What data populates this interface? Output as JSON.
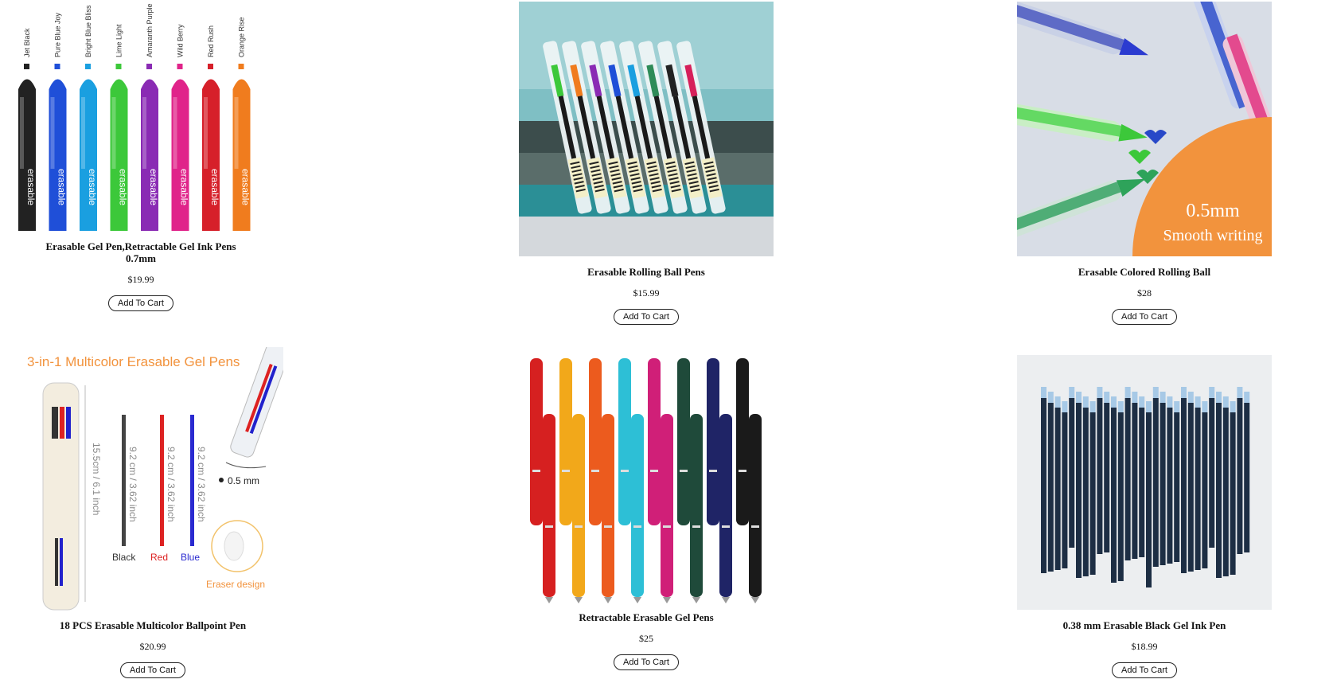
{
  "products": [
    {
      "title": "Erasable Gel Pen,Retractable Gel Ink Pens 0.7mm",
      "price": "$19.99",
      "button": "Add To Cart",
      "image_labels": [
        "Jet Black",
        "Pure Blue Joy",
        "Bright Blue Bliss",
        "Lime Light",
        "Amaranth Purple",
        "Wild Berry",
        "Red Rush",
        "Orange Rise"
      ],
      "barrel_text": "erasable",
      "colors": [
        "#222222",
        "#1f4fd8",
        "#1a9fe0",
        "#3cc83a",
        "#8a2bb4",
        "#e0248a",
        "#d6202a",
        "#f07c1e"
      ]
    },
    {
      "title": "Erasable Rolling Ball Pens",
      "price": "$15.99",
      "button": "Add To Cart",
      "colors": [
        "#3cc83a",
        "#f07c1e",
        "#8a2bb4",
        "#1f4fd8",
        "#1a9fe0",
        "#2e8b57",
        "#222222",
        "#d6205a"
      ]
    },
    {
      "title": "Erasable Colored Rolling Ball",
      "price": "$28",
      "button": "Add To Cart",
      "badge_size": "0.5mm",
      "badge_text": "Smooth writing"
    },
    {
      "title": "18 PCS Erasable Multicolor Ballpoint Pen",
      "price": "$20.99",
      "button": "Add To Cart",
      "header": "3-in-1 Multicolor Erasable Gel Pens",
      "length_label": "15.5cm / 6.1 inch",
      "refill_label": "9.2 cm / 3.62 inch",
      "tip_label": "0.5 mm",
      "refills": [
        "Black",
        "Red",
        "Blue"
      ],
      "eraser_label": "Eraser design"
    },
    {
      "title": "Retractable Erasable Gel Pens",
      "price": "$25",
      "button": "Add To Cart",
      "colors": [
        "#d62020",
        "#f2a81a",
        "#ec5b1e",
        "#2dbfd6",
        "#d01f78",
        "#1f4a3a",
        "#1f2466",
        "#1a1a1a"
      ]
    },
    {
      "title": "0.38 mm Erasable Black Gel Ink Pen",
      "price": "$18.99",
      "button": "Add To Cart"
    }
  ]
}
